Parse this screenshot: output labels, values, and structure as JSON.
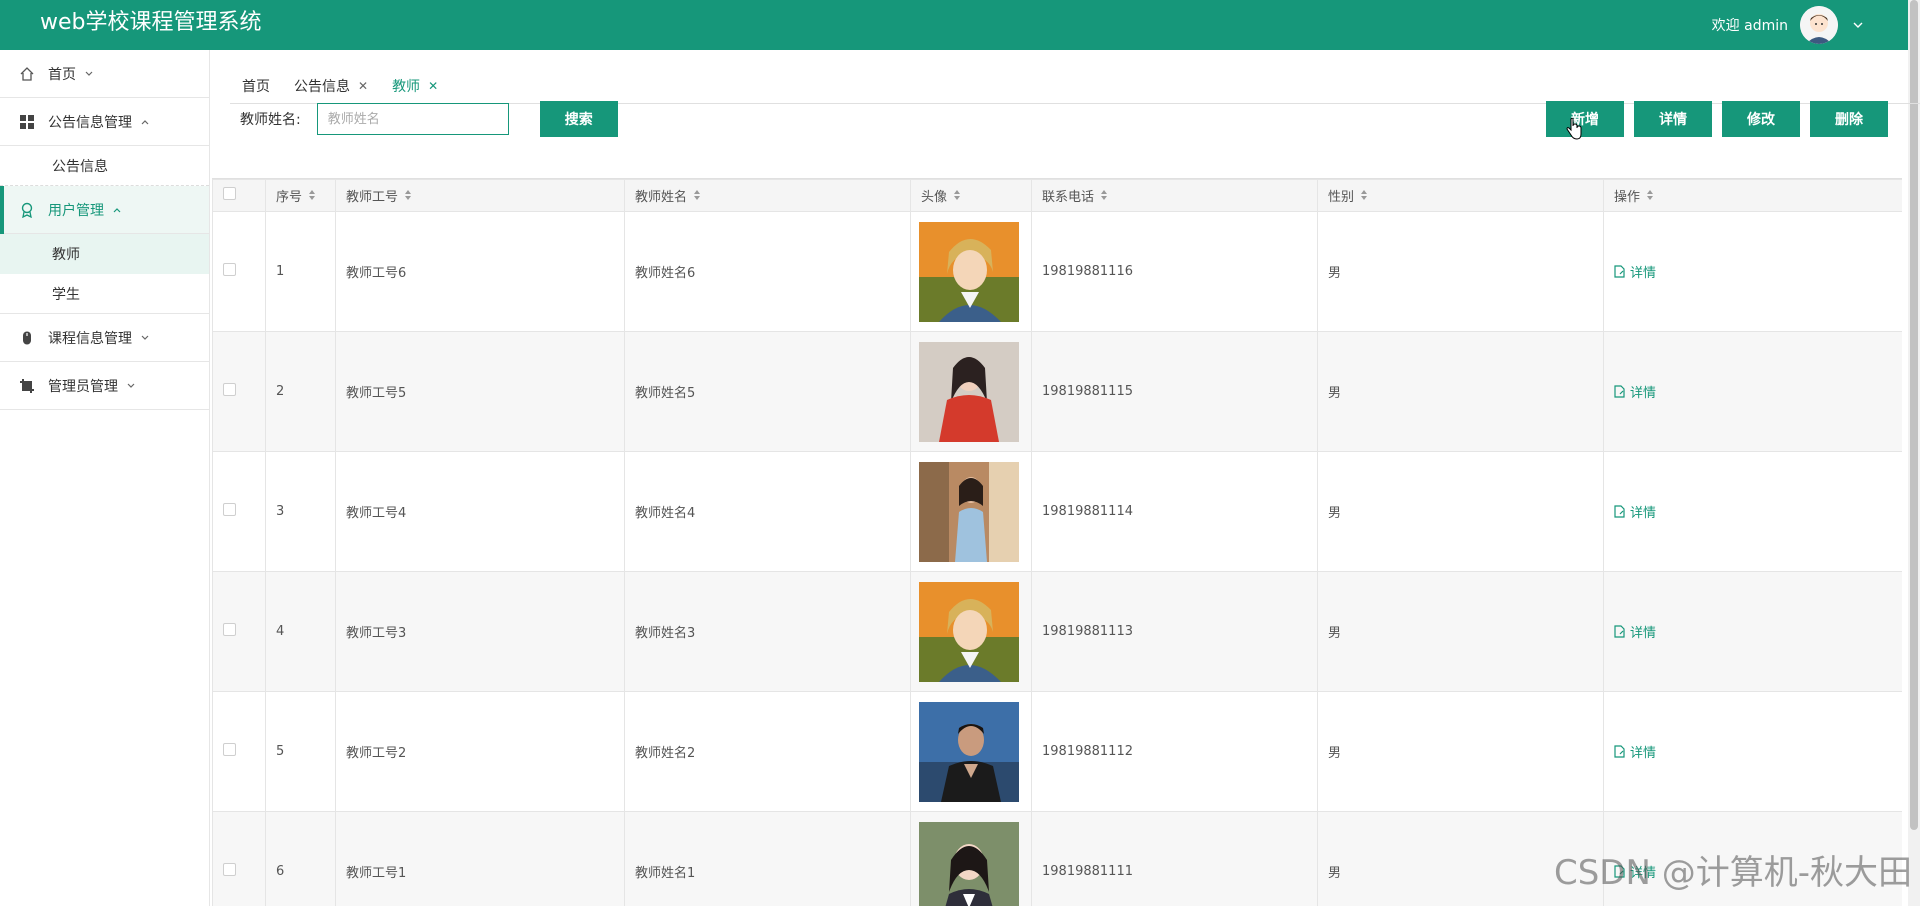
{
  "header": {
    "title": "web学校课程管理系统",
    "welcome": "欢迎 admin",
    "color": "#16977a"
  },
  "sidebar": {
    "items": [
      {
        "label": "首页",
        "icon": "home-icon",
        "expanded": false
      },
      {
        "label": "公告信息管理",
        "icon": "grid-icon",
        "expanded": true,
        "children": [
          "公告信息"
        ]
      },
      {
        "label": "用户管理",
        "icon": "badge-icon",
        "expanded": true,
        "active": true,
        "children": [
          "教师",
          "学生"
        ]
      },
      {
        "label": "课程信息管理",
        "icon": "mouse-icon",
        "expanded": false
      },
      {
        "label": "管理员管理",
        "icon": "crop-icon",
        "expanded": false
      }
    ]
  },
  "tabs": [
    {
      "label": "首页",
      "closable": false
    },
    {
      "label": "公告信息",
      "closable": true
    },
    {
      "label": "教师",
      "closable": true,
      "active": true
    }
  ],
  "search": {
    "label": "教师姓名:",
    "placeholder": "教师姓名",
    "button": "搜索"
  },
  "actions": [
    "新增",
    "详情",
    "修改",
    "删除"
  ],
  "table": {
    "columns": [
      "序号",
      "教师工号",
      "教师姓名",
      "头像",
      "联系电话",
      "性别",
      "操作"
    ],
    "rows": [
      {
        "no": "1",
        "id": "教师工号6",
        "name": "教师姓名6",
        "phone": "19819881116",
        "gender": "男",
        "op": "详情",
        "avatar": "anime"
      },
      {
        "no": "2",
        "id": "教师工号5",
        "name": "教师姓名5",
        "phone": "19819881115",
        "gender": "男",
        "op": "详情",
        "avatar": "red"
      },
      {
        "no": "3",
        "id": "教师工号4",
        "name": "教师姓名4",
        "phone": "19819881114",
        "gender": "男",
        "op": "详情",
        "avatar": "street"
      },
      {
        "no": "4",
        "id": "教师工号3",
        "name": "教师姓名3",
        "phone": "19819881113",
        "gender": "男",
        "op": "详情",
        "avatar": "anime"
      },
      {
        "no": "5",
        "id": "教师工号2",
        "name": "教师姓名2",
        "phone": "19819881112",
        "gender": "男",
        "op": "详情",
        "avatar": "boy"
      },
      {
        "no": "6",
        "id": "教师工号1",
        "name": "教师姓名1",
        "phone": "19819881111",
        "gender": "男",
        "op": "详情",
        "avatar": "girl"
      }
    ]
  },
  "watermark": "CSDN @计算机-秋大田"
}
